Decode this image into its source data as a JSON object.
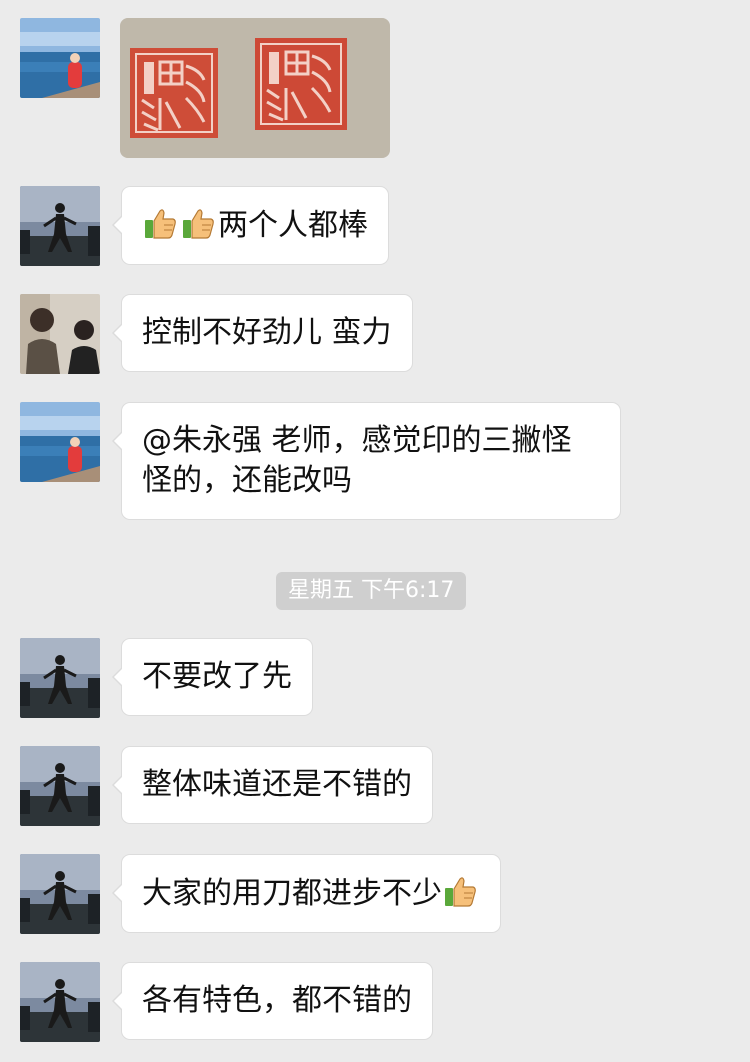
{
  "chat": {
    "timestamp": "星期五 下午6:17",
    "messages": [
      {
        "sender": "sea-avatar",
        "type": "image",
        "content": "seal-stamps-photo"
      },
      {
        "sender": "dark-avatar",
        "type": "text",
        "emoji_prefix": [
          "thumbs-up-icon",
          "thumbs-up-icon"
        ],
        "text": "两个人都棒"
      },
      {
        "sender": "couple-avatar",
        "type": "text",
        "text": "控制不好劲儿 蛮力"
      },
      {
        "sender": "sea-avatar",
        "type": "text",
        "line1": "@朱永强 老师，感觉印的三撇怪",
        "line2": "怪的，还能改吗"
      },
      {
        "sender": "dark-avatar",
        "type": "text",
        "text": "不要改了先"
      },
      {
        "sender": "dark-avatar",
        "type": "text",
        "text": "整体味道还是不错的"
      },
      {
        "sender": "dark-avatar",
        "type": "text",
        "text": "大家的用刀都进步不少",
        "emoji_suffix": "thumbs-up-icon"
      },
      {
        "sender": "dark-avatar",
        "type": "text",
        "text": "各有特色，都不错的"
      }
    ]
  },
  "colors": {
    "background": "#ebebeb",
    "bubble": "#ffffff",
    "seal_red": "#c9331f",
    "time_badge": "#cfcfcf"
  }
}
